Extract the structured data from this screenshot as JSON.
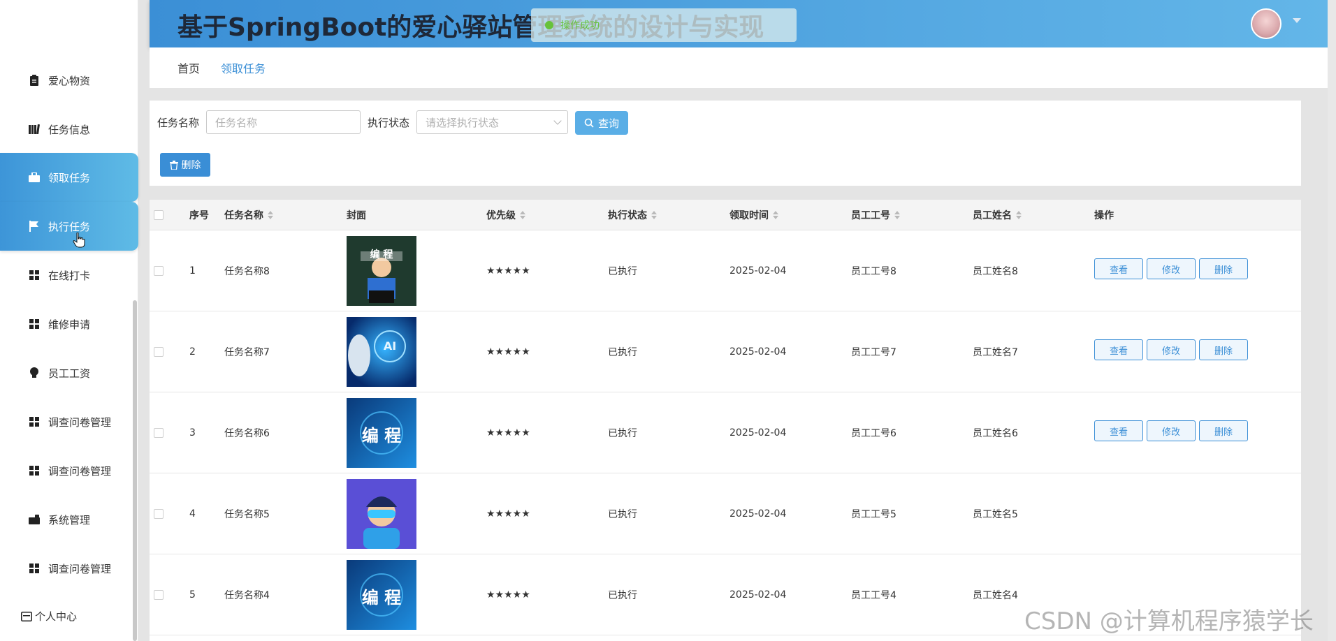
{
  "header": {
    "title": "基于SpringBoot的爱心驿站管理系统的设计与实现",
    "toast": "操作成功"
  },
  "sidebar": {
    "items": [
      {
        "label": "爱心物资",
        "icon": "clipboard-icon"
      },
      {
        "label": "任务信息",
        "icon": "books-icon"
      },
      {
        "label": "领取任务",
        "icon": "briefcase-icon",
        "active": true
      },
      {
        "label": "执行任务",
        "icon": "flag-icon",
        "active": true
      },
      {
        "label": "在线打卡",
        "icon": "grid-icon"
      },
      {
        "label": "维修申请",
        "icon": "grid-icon"
      },
      {
        "label": "员工工资",
        "icon": "bulb-icon"
      },
      {
        "label": "调查问卷管理",
        "icon": "grid-icon"
      },
      {
        "label": "调查问卷管理",
        "icon": "grid-icon"
      },
      {
        "label": "系统管理",
        "icon": "briefcase-icon"
      },
      {
        "label": "调查问卷管理",
        "icon": "grid-icon"
      }
    ],
    "personal_center": "个人中心"
  },
  "breadcrumb": {
    "home": "首页",
    "current": "领取任务"
  },
  "search": {
    "task_name_label": "任务名称",
    "task_name_placeholder": "任务名称",
    "status_label": "执行状态",
    "status_placeholder": "请选择执行状态",
    "query_button": "查询",
    "delete_button": "删除"
  },
  "table": {
    "columns": {
      "index": "序号",
      "task_name": "任务名称",
      "cover": "封面",
      "priority": "优先级",
      "status": "执行状态",
      "claim_time": "领取时间",
      "employee_no": "员工工号",
      "employee_name": "员工姓名",
      "actions": "操作"
    },
    "action_labels": {
      "view": "查看",
      "edit": "修改",
      "delete": "删除"
    },
    "rows": [
      {
        "index": "1",
        "task_name": "任务名称8",
        "priority": "★★★★★",
        "status": "已执行",
        "claim_time": "2025-02-04",
        "employee_no": "员工工号8",
        "employee_name": "员工姓名8",
        "cover_text": "编 程"
      },
      {
        "index": "2",
        "task_name": "任务名称7",
        "priority": "★★★★★",
        "status": "已执行",
        "claim_time": "2025-02-04",
        "employee_no": "员工工号7",
        "employee_name": "员工姓名7",
        "cover_text": "AI"
      },
      {
        "index": "3",
        "task_name": "任务名称6",
        "priority": "★★★★★",
        "status": "已执行",
        "claim_time": "2025-02-04",
        "employee_no": "员工工号6",
        "employee_name": "员工姓名6",
        "cover_text": "编 程"
      },
      {
        "index": "4",
        "task_name": "任务名称5",
        "priority": "★★★★★",
        "status": "已执行",
        "claim_time": "2025-02-04",
        "employee_no": "员工工号5",
        "employee_name": "员工姓名5",
        "cover_text": ""
      },
      {
        "index": "5",
        "task_name": "任务名称4",
        "priority": "★★★★★",
        "status": "已执行",
        "claim_time": "2025-02-04",
        "employee_no": "员工工号4",
        "employee_name": "员工姓名4",
        "cover_text": "编 程"
      }
    ]
  },
  "watermark": "CSDN @计算机程序猿学长",
  "colors": {
    "accent": "#3a8ed6",
    "header_start": "#3b8fd6",
    "header_end": "#63b6e8",
    "success": "#67c23a"
  }
}
